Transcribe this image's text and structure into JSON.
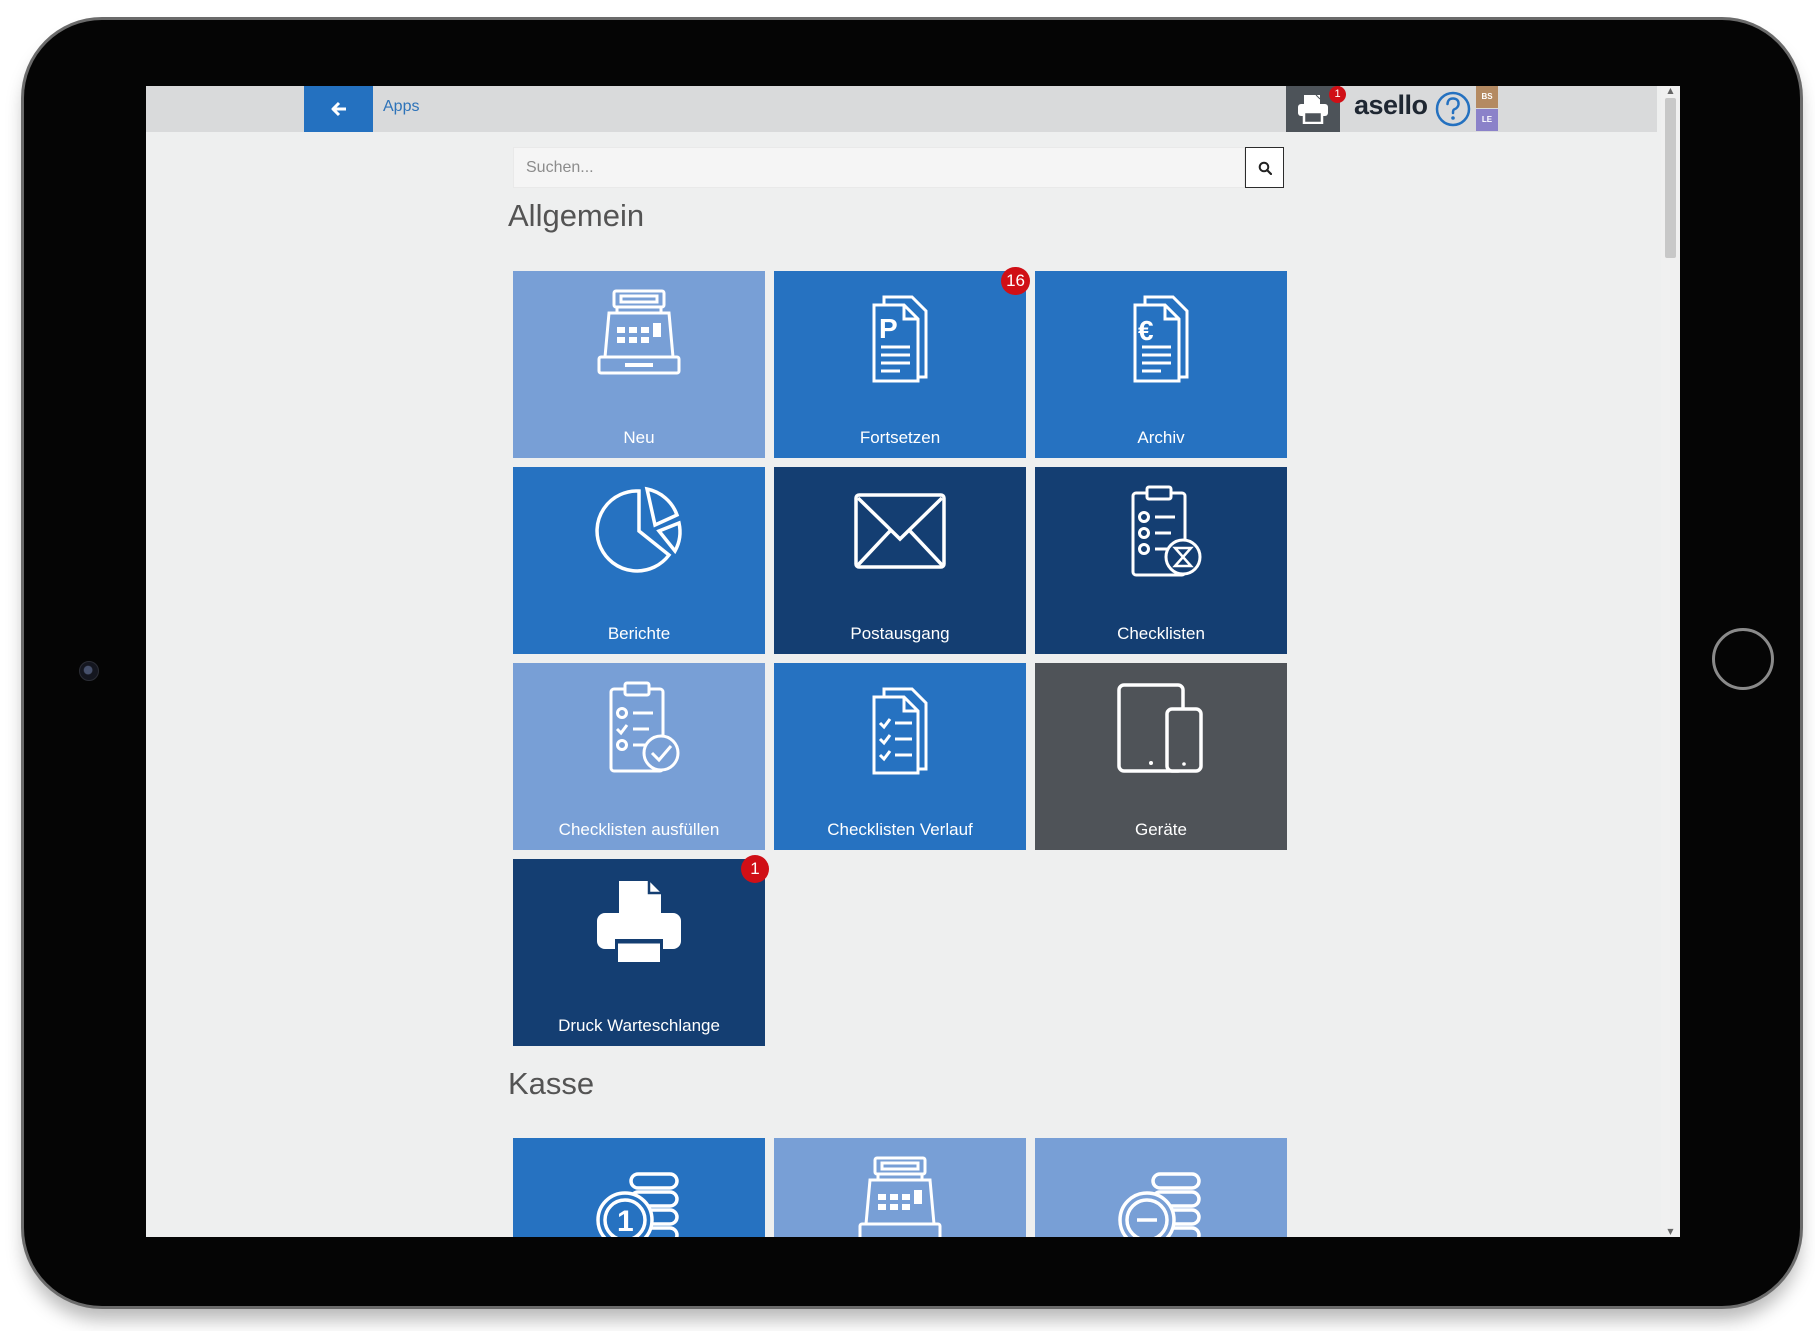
{
  "topbar": {
    "back_icon": "arrow-left-icon",
    "breadcrumb": "Apps",
    "print_badge": "1",
    "brand": "asello",
    "tags": [
      "BS",
      "LE"
    ]
  },
  "search": {
    "placeholder": "Suchen...",
    "value": ""
  },
  "sections": [
    {
      "title": "Allgemein",
      "tiles": [
        {
          "label": "Neu",
          "icon": "cash-register-icon",
          "color": "#789fd6",
          "badge": ""
        },
        {
          "label": "Fortsetzen",
          "icon": "parking-document-icon",
          "color": "#2672c1",
          "badge": "16"
        },
        {
          "label": "Archiv",
          "icon": "euro-document-icon",
          "color": "#2672c1",
          "badge": ""
        },
        {
          "label": "Berichte",
          "icon": "pie-chart-icon",
          "color": "#2672c1",
          "badge": ""
        },
        {
          "label": "Postausgang",
          "icon": "envelope-icon",
          "color": "#143e72",
          "badge": ""
        },
        {
          "label": "Checklisten",
          "icon": "clipboard-hourglass-icon",
          "color": "#143e72",
          "badge": ""
        },
        {
          "label": "Checklisten ausfüllen",
          "icon": "clipboard-check-icon",
          "color": "#789fd6",
          "badge": ""
        },
        {
          "label": "Checklisten Verlauf",
          "icon": "checklist-documents-icon",
          "color": "#2672c1",
          "badge": ""
        },
        {
          "label": "Geräte",
          "icon": "devices-icon",
          "color": "#4f5358",
          "badge": ""
        },
        {
          "label": "Druck Warteschlange",
          "icon": "printer-icon",
          "color": "#143e72",
          "badge": "1"
        }
      ]
    },
    {
      "title": "Kasse",
      "tiles": [
        {
          "label": "",
          "icon": "coins-one-icon",
          "color": "#2672c1",
          "badge": ""
        },
        {
          "label": "",
          "icon": "cash-register-icon",
          "color": "#789fd6",
          "badge": ""
        },
        {
          "label": "",
          "icon": "coins-minus-icon",
          "color": "#789fd6",
          "badge": ""
        }
      ]
    }
  ],
  "colors": {
    "accent": "#2471c0",
    "badge": "#d00f16",
    "tile_light": "#789fd6",
    "tile_mid": "#2672c1",
    "tile_dark": "#143e72",
    "tile_grey": "#4f5358"
  }
}
